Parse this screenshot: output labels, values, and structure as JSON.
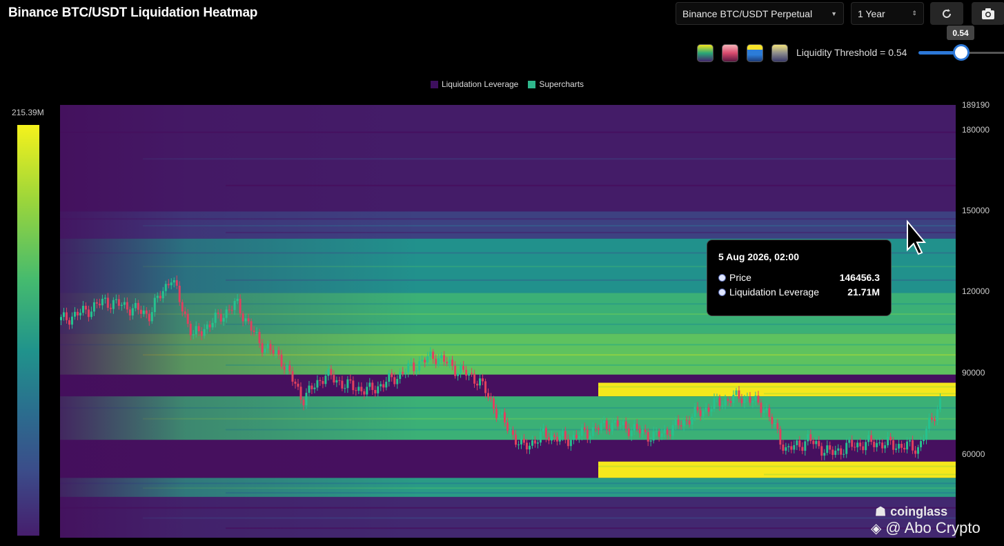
{
  "header": {
    "title": "Binance BTC/USDT Liquidation Heatmap",
    "pair_select": "Binance BTC/USDT Perpetual",
    "range_select": "1 Year",
    "refresh_icon": "refresh-icon",
    "camera_icon": "camera-icon"
  },
  "controls": {
    "threshold_label": "Liquidity Threshold = 0.54",
    "threshold_value": "0.54",
    "threshold_fraction": 0.54,
    "color_schemes": [
      "viridis",
      "pink-red",
      "blue-yellow",
      "gray-yellow"
    ]
  },
  "legend": {
    "item1": "Liquidation Leverage",
    "item1_color": "#3d0f5e",
    "item2": "Supercharts",
    "item2_color": "#2fb78c"
  },
  "colorbar": {
    "max_label": "215.39M"
  },
  "tooltip": {
    "date": "5 Aug 2026, 02:00",
    "price_label": "Price",
    "price_value": "146456.3",
    "lev_label": "Liquidation Leverage",
    "lev_value": "21.71M"
  },
  "watermark": {
    "brand": "coinglass",
    "author": "@ Abo Crypto"
  },
  "chart_data": {
    "type": "heatmap",
    "title": "Binance BTC/USDT Liquidation Heatmap",
    "y_ticks": [
      "189190",
      "180000",
      "150000",
      "120000",
      "90000",
      "60000"
    ],
    "y_tick_values": [
      189190,
      180000,
      150000,
      120000,
      90000,
      60000
    ],
    "ylim": [
      30000,
      189190
    ],
    "colorscale_max": "215.39M",
    "series": [
      {
        "name": "Liquidation Leverage",
        "note": "heatmap bands",
        "bands": [
          {
            "price_low": 150000,
            "price_high": 189190,
            "intensity": 0.05
          },
          {
            "price_low": 140000,
            "price_high": 150000,
            "intensity": 0.2
          },
          {
            "price_low": 120000,
            "price_high": 140000,
            "intensity": 0.45
          },
          {
            "price_low": 105000,
            "price_high": 120000,
            "intensity": 0.6
          },
          {
            "price_low": 90000,
            "price_high": 105000,
            "intensity": 0.7
          },
          {
            "price_low": 82000,
            "price_high": 87000,
            "intensity": 1.0
          },
          {
            "price_low": 66000,
            "price_high": 82000,
            "intensity": 0.6
          },
          {
            "price_low": 52000,
            "price_high": 58000,
            "intensity": 1.0
          },
          {
            "price_low": 45000,
            "price_high": 52000,
            "intensity": 0.5
          },
          {
            "price_low": 30000,
            "price_high": 45000,
            "intensity": 0.1
          }
        ]
      },
      {
        "name": "Supercharts",
        "note": "BTC price path (approx.)",
        "price_path": [
          110000,
          113000,
          117000,
          115000,
          112000,
          126000,
          104000,
          110000,
          116000,
          102000,
          96000,
          81000,
          90000,
          86000,
          84000,
          88000,
          93000,
          97000,
          92000,
          88000,
          74000,
          63000,
          68000,
          66000,
          69000,
          72000,
          70000,
          67000,
          71000,
          76000,
          80000,
          82000,
          78000,
          62000,
          66000,
          61000,
          64000,
          65000,
          64000,
          63000,
          80000
        ]
      }
    ]
  }
}
